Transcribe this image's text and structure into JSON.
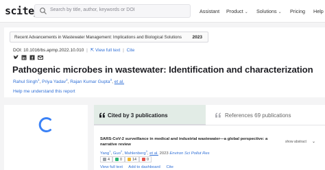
{
  "header": {
    "logo": "scite_",
    "search_placeholder": "Search by title, author, keywords or DOI",
    "nav": {
      "assistant": "Assistant",
      "product": "Product",
      "solutions": "Solutions",
      "pricing": "Pricing",
      "help": "Help"
    }
  },
  "paper": {
    "journal": "Recent Advancements in Wastewater Management: Implications and Biological Solutions",
    "year": "2023",
    "doi": "DOI: 10.1016/bs.apmp.2022.10.010",
    "view_full_text": "View full text",
    "cite": "Cite",
    "title": "Pathogenic microbes in wastewater: Identification and characterization",
    "authors": [
      {
        "name": "Rahul Singh",
        "sup": "1"
      },
      {
        "name": "Priya Yadav",
        "sup": "2"
      },
      {
        "name": "Rajan Kumar Gupta",
        "sup": "3"
      }
    ],
    "et_al": "et al.",
    "help_link": "Help me understand this report"
  },
  "citations": {
    "tab_cited": "Cited by 3 publications",
    "tab_references": "References 69 publications",
    "item": {
      "title": "SARS-CoV-2 surveillance in medical and industrial wastewater—a global perspective: a narrative review",
      "show_abstract": "show abstract",
      "authors": [
        {
          "name": "Yang",
          "sup": "1"
        },
        {
          "name": "Guo",
          "sup": "2"
        },
        {
          "name": "Mahlenberg",
          "sup": "3"
        }
      ],
      "et_al": "et al.",
      "year": "2023",
      "journal": "Environ Sci Pollut Res",
      "stats": [
        "4",
        "0",
        "14",
        "0"
      ],
      "actions": [
        "View full text",
        "Add to dashboard",
        "Cite"
      ]
    }
  },
  "colors": {
    "link": "#2f6fd6",
    "active_tab": "#e2ece6",
    "spinner": "#3b82f6"
  }
}
